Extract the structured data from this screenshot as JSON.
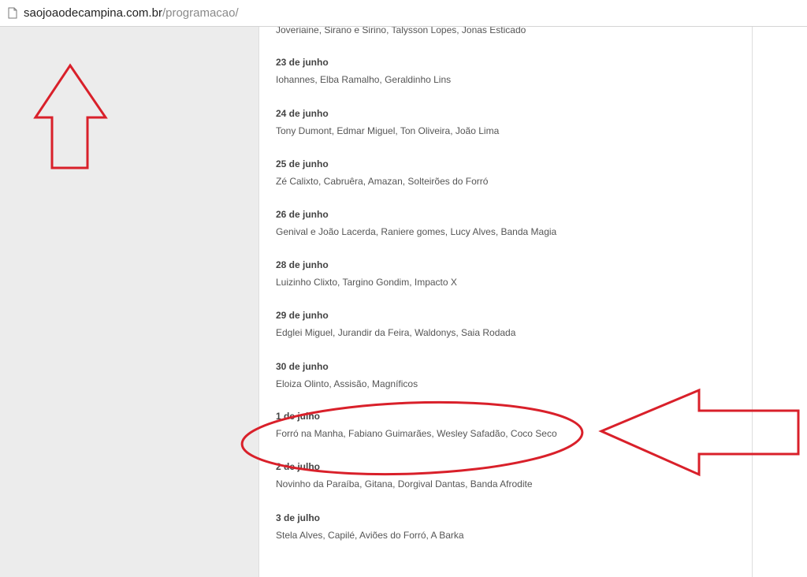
{
  "browser": {
    "url_domain": "saojoaodecampina.com.br",
    "url_path": "/programacao/"
  },
  "schedule": {
    "cut_off_line": "Joveriaine, Sirano e Sirino, Talysson Lopes, Jonas Esticado",
    "entries": [
      {
        "date": "23 de junho",
        "artists": "Iohannes, Elba Ramalho, Geraldinho Lins"
      },
      {
        "date": "24 de junho",
        "artists": "Tony Dumont, Edmar Miguel, Ton Oliveira, João Lima"
      },
      {
        "date": "25 de junho",
        "artists": "Zé Calixto, Cabruêra, Amazan, Solteirões do Forró"
      },
      {
        "date": "26 de junho",
        "artists": "Genival e João Lacerda, Raniere gomes, Lucy Alves, Banda Magia"
      },
      {
        "date": "28 de junho",
        "artists": "Luizinho Clixto, Targino Gondim, Impacto X"
      },
      {
        "date": "29 de junho",
        "artists": "Edglei Miguel, Jurandir da Feira, Waldonys, Saia Rodada"
      },
      {
        "date": "30 de junho",
        "artists": "Eloiza Olinto, Assisão, Magníficos"
      },
      {
        "date": "1 de julho",
        "artists": "Forró na Manha, Fabiano Guimarães, Wesley Safadão, Coco Seco"
      },
      {
        "date": "2 de julho",
        "artists": "Novinho da Paraíba, Gitana, Dorgival Dantas, Banda Afrodite"
      },
      {
        "date": "3 de julho",
        "artists": "Stela Alves, Capilé, Aviões do Forró, A Barka"
      }
    ]
  },
  "annotations": {
    "color": "#d9202a",
    "up_arrow_icon": "arrow-up-outline",
    "left_arrow_icon": "arrow-left-outline",
    "highlight": "ellipse-around-1-de-julho"
  }
}
